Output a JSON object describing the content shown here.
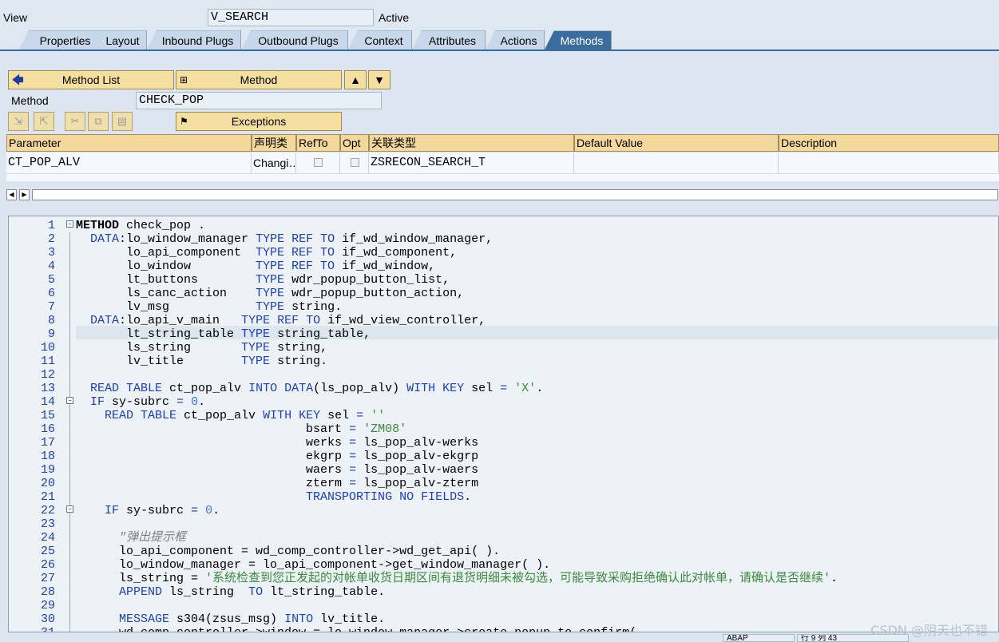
{
  "header": {
    "view_label": "View",
    "view_value": "V_SEARCH",
    "status": "Active"
  },
  "tabs": [
    {
      "label": "Properties"
    },
    {
      "label": "Layout"
    },
    {
      "label": "Inbound Plugs"
    },
    {
      "label": "Outbound Plugs"
    },
    {
      "label": "Context"
    },
    {
      "label": "Attributes"
    },
    {
      "label": "Actions"
    },
    {
      "label": "Methods"
    }
  ],
  "toolbar": {
    "method_list_label": "Method List",
    "method_label": "Method",
    "back_icon": "arrow-left-icon",
    "method_icon": "hierarchy-icon",
    "up_icon": "triangle-up-icon",
    "down_icon": "triangle-down-icon"
  },
  "method": {
    "label": "Method",
    "value": "CHECK_POP"
  },
  "exceptions_label": "Exceptions",
  "params": {
    "headers": [
      "Parameter",
      "声明类",
      "RefTo",
      "Opt",
      "关联类型",
      "Default Value",
      "Description"
    ],
    "row": {
      "parameter": "CT_POP_ALV",
      "decl": "Changi…",
      "refto": false,
      "opt": false,
      "type": "ZSRECON_SEARCH_T",
      "default": "",
      "description": ""
    }
  },
  "code": {
    "line_numbers": [
      "1",
      "2",
      "3",
      "4",
      "5",
      "6",
      "7",
      "8",
      "9",
      "10",
      "11",
      "12",
      "13",
      "14",
      "15",
      "16",
      "17",
      "18",
      "19",
      "20",
      "21",
      "22",
      "23",
      "24",
      "25",
      "26",
      "27",
      "28",
      "29",
      "30",
      "31"
    ]
  },
  "statusbar": {
    "lang": "ABAP",
    "position": "行 9 列 43"
  },
  "watermark": "CSDN @阴天也不错",
  "colors": {
    "keyword": "#1c3fb8",
    "string": "#3a8a3a",
    "comment": "#7f7f7f",
    "active_tab": "#3a6d9e",
    "button_bg": "#f5dfa0"
  }
}
